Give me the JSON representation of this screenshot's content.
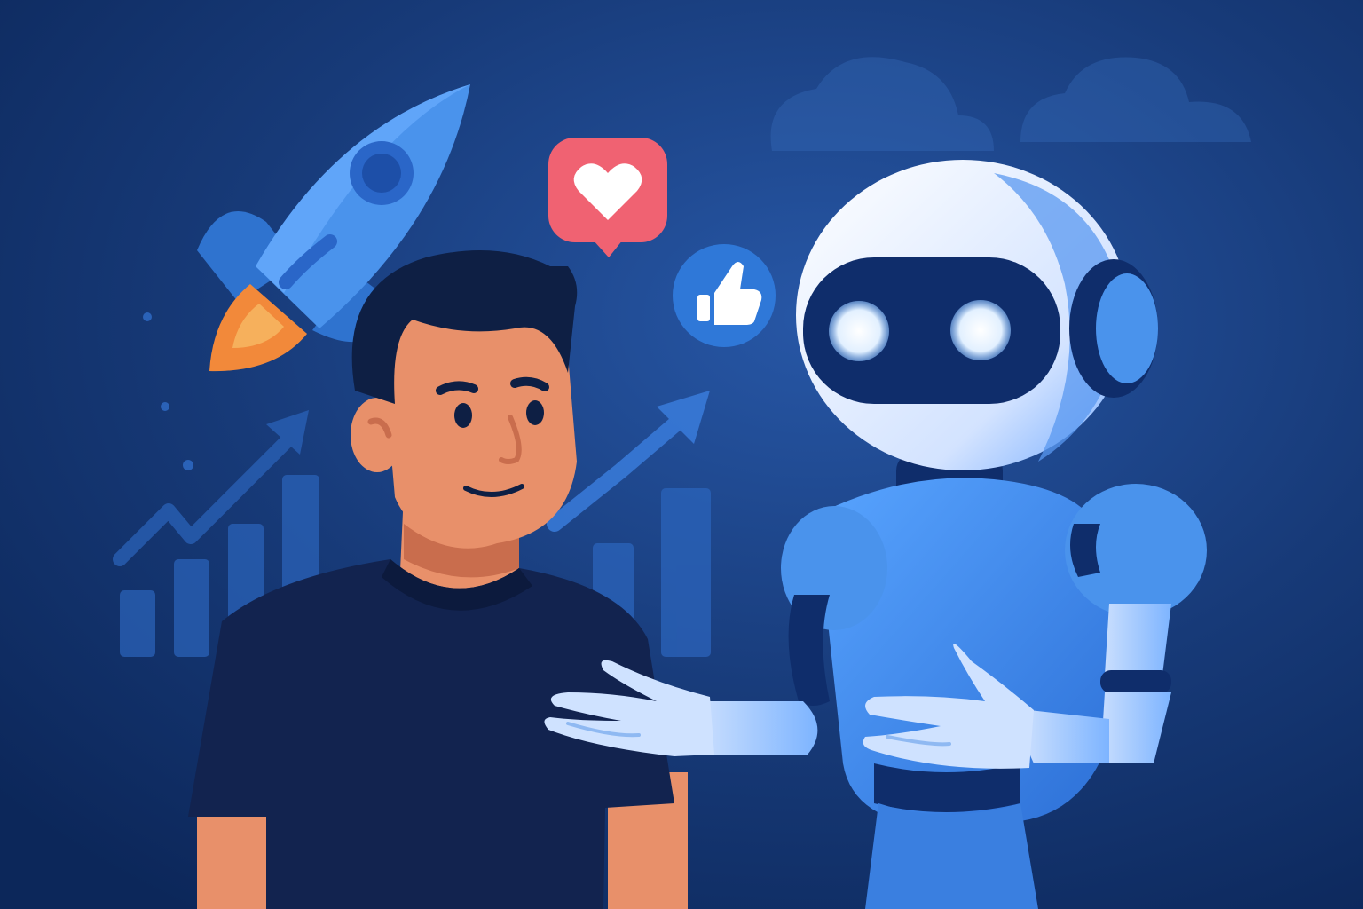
{
  "scene": {
    "elements": [
      "rocket-icon",
      "heart-bubble-icon",
      "thumbs-up-icon",
      "growth-chart-left",
      "growth-chart-right",
      "person-figure",
      "robot-figure",
      "cloud-shapes"
    ]
  },
  "colors": {
    "background_top": "#173a78",
    "background_bottom": "#0f2f66",
    "chart_blue": "#2a62b8",
    "rocket_body": "#3f8ae6",
    "rocket_flame": "#f2893a",
    "heart_bubble": "#f06272",
    "thumb_badge": "#2f78d8",
    "skin": "#e8906a",
    "hair": "#0e1f44",
    "shirt": "#12234f",
    "robot_head": "#e6efff",
    "robot_body": "#3f8ae6",
    "robot_dark": "#0f2d6b",
    "robot_eyes": "#eef6ff"
  }
}
